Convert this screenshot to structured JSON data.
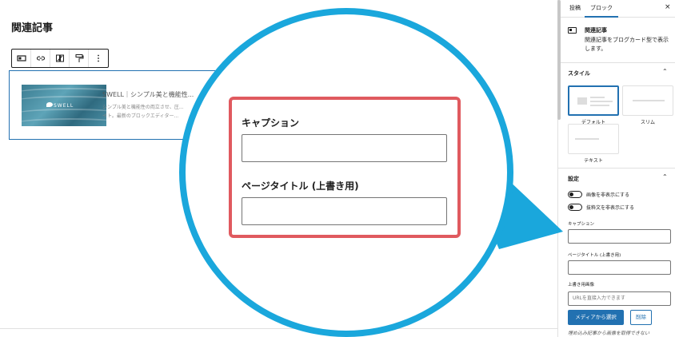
{
  "editor": {
    "title": "関連記事",
    "toolbar": {
      "buttons": [
        "block-type-icon",
        "link-icon",
        "style-icon",
        "paint-roller-icon",
        "more-options-icon"
      ]
    },
    "card": {
      "title": "SWELL｜シンプル美と機能性...",
      "excerpt_line1": "シンプル美と機能性の両立させ、圧...",
      "excerpt_line2": "イト。最新のブロックエディター...",
      "thumb_text": "SWELL"
    }
  },
  "magnifier": {
    "caption_label": "キャプション",
    "caption_value": "",
    "page_title_label": "ページタイトル (上書き用)",
    "page_title_value": ""
  },
  "sidebar": {
    "tabs": {
      "post": "投稿",
      "block": "ブロック"
    },
    "close_icon": "×",
    "block": {
      "name": "関連記事",
      "description": "関連記事をブログカード型で表示します。"
    },
    "style_section": {
      "heading": "スタイル",
      "options": [
        {
          "label": "デフォルト",
          "active": true
        },
        {
          "label": "スリム",
          "active": false
        },
        {
          "label": "テキスト",
          "active": false
        }
      ]
    },
    "settings_section": {
      "heading": "設定",
      "toggles": [
        {
          "label": "画像を非表示にする"
        },
        {
          "label": "抜粋文を非表示にする"
        }
      ],
      "caption_label": "キャプション",
      "caption_value": "",
      "page_title_label": "ページタイトル (上書き用)",
      "page_title_value": "",
      "image_label": "上書き用画像",
      "image_placeholder": "URLを直接入力できます",
      "media_button": "メディアから選択",
      "delete_button": "削除",
      "help_text": "埋め込み記事から画像を取得できない"
    }
  },
  "colors": {
    "accent": "#2271b1",
    "magnifier_ring": "#1aa7dc",
    "highlight_border": "#e05a5f"
  }
}
